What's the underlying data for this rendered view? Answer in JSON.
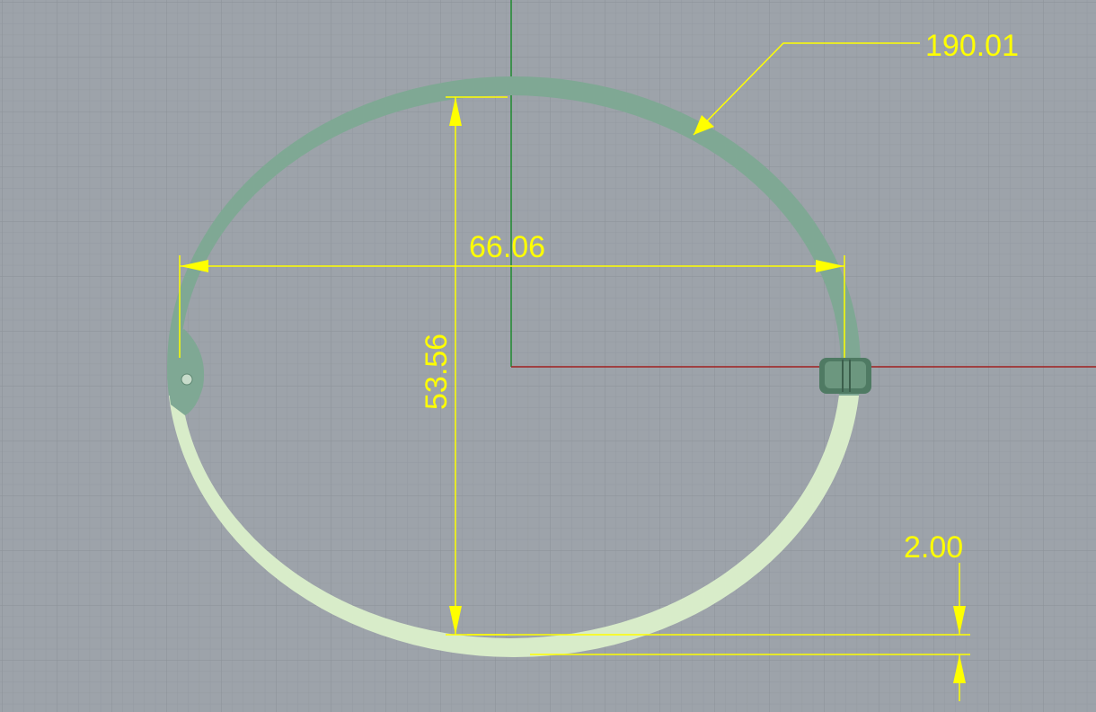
{
  "viewport": {
    "background": "#9da3aa",
    "grid_minor_color": "#949aa1",
    "grid_major_color": "#8a9097",
    "x_axis_color": "#a02020",
    "y_axis_color": "#1f8a2f"
  },
  "part": {
    "upper_color": "#7fa894",
    "lower_color": "#d8ecc9",
    "pin_color": "#4f7a63"
  },
  "dimensions": {
    "color": "#ffff00",
    "arc_length": "190.01",
    "width": "66.06",
    "height": "53.56",
    "thickness": "2.00"
  }
}
